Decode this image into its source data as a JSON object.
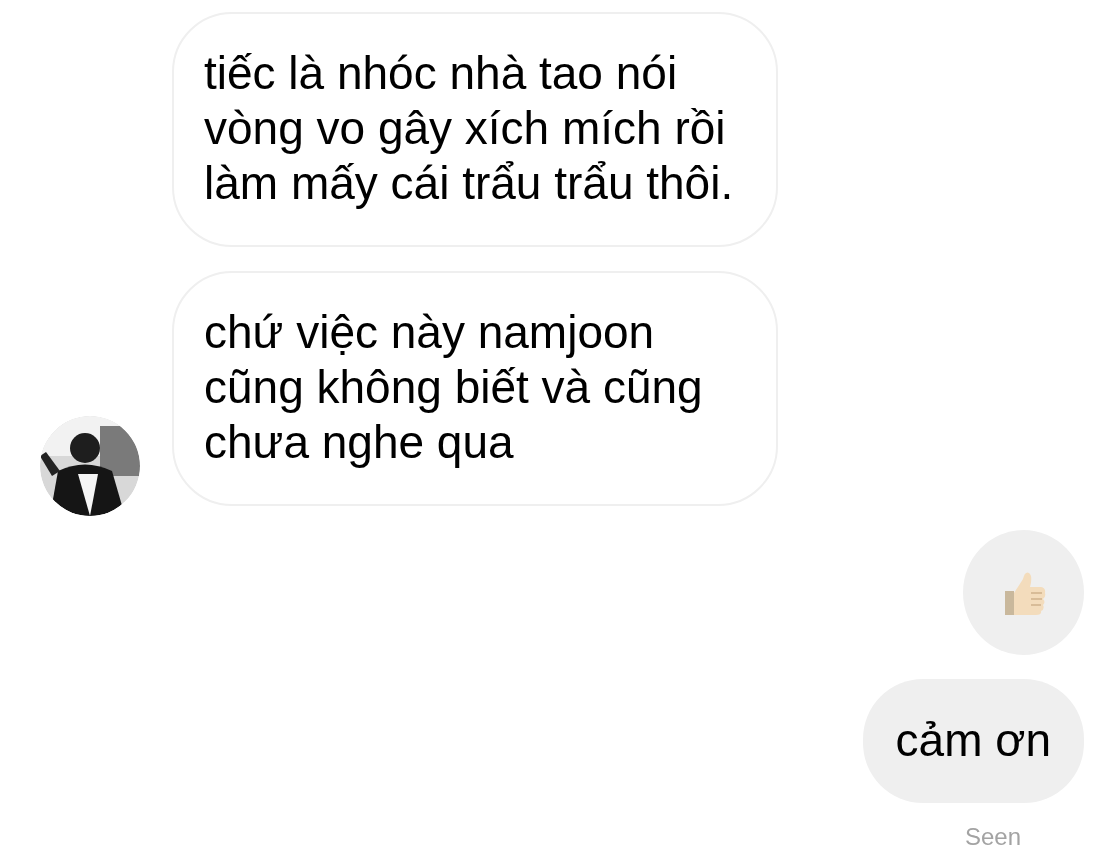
{
  "messages": [
    {
      "kind": "text",
      "outgoing": false,
      "text": "tiếc là nhóc nhà tao nói vòng vo gây xích mích rồi làm mấy cái trẩu trẩu thôi."
    },
    {
      "kind": "text",
      "outgoing": false,
      "text": "chứ việc này namjoon cũng không biết và cũng chưa nghe qua"
    },
    {
      "kind": "like",
      "outgoing": true
    },
    {
      "kind": "text",
      "outgoing": true,
      "text": "cảm ơn"
    }
  ],
  "status": "Seen"
}
